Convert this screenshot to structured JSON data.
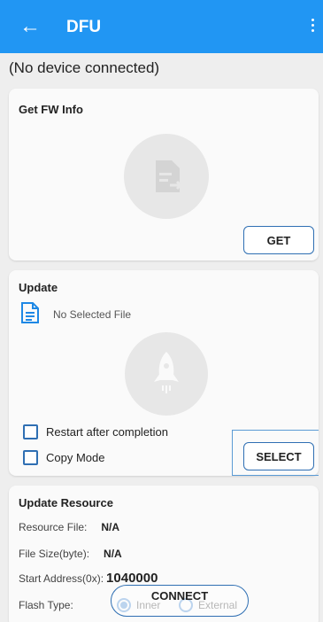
{
  "appbar": {
    "back_icon": "arrow-left-icon",
    "title": "DFU",
    "more_icon": "more-vert-icon"
  },
  "status": "(No device connected)",
  "fw_info": {
    "title": "Get FW Info",
    "icon": "file-arrow-icon",
    "get_label": "GET"
  },
  "update": {
    "title": "Update",
    "file_icon": "document-icon",
    "file_text": "No Selected File",
    "rocket_icon": "rocket-icon",
    "restart_label": "Restart after completion",
    "restart_checked": false,
    "copy_label": "Copy Mode",
    "copy_checked": false,
    "select_label": "SELECT"
  },
  "resource": {
    "title": "Update Resource",
    "resource_file_label": "Resource File:",
    "resource_file_value": "N/A",
    "file_size_label": "File Size(byte):",
    "file_size_value": "N/A",
    "start_address_label": "Start Address(0x):",
    "start_address_value": "1040000",
    "flash_type_label": "Flash Type:",
    "flash_options": [
      "Inner",
      "External"
    ],
    "flash_selected": "Inner"
  },
  "connect_label": "CONNECT",
  "colors": {
    "primary": "#2196f3",
    "outline": "#2f6fb3",
    "background": "#eeeeee"
  }
}
